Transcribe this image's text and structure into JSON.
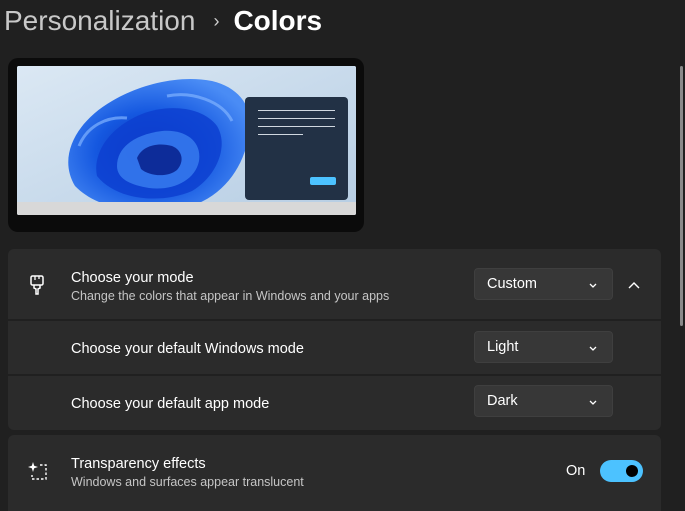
{
  "breadcrumb": {
    "parent": "Personalization",
    "separator": "›",
    "current": "Colors"
  },
  "mode_section": {
    "icon": "paintbrush-icon",
    "title": "Choose your mode",
    "description": "Change the colors that appear in Windows and your apps",
    "value": "Custom",
    "expanded": true
  },
  "windows_mode": {
    "title": "Choose your default Windows mode",
    "value": "Light"
  },
  "app_mode": {
    "title": "Choose your default app mode",
    "value": "Dark"
  },
  "transparency": {
    "icon": "transparency-sparkle-icon",
    "title": "Transparency effects",
    "description": "Windows and surfaces appear translucent",
    "state": "On",
    "enabled": true
  },
  "colors": {
    "background": "#202020",
    "card": "#2b2b2b",
    "accent": "#4cc2ff"
  }
}
